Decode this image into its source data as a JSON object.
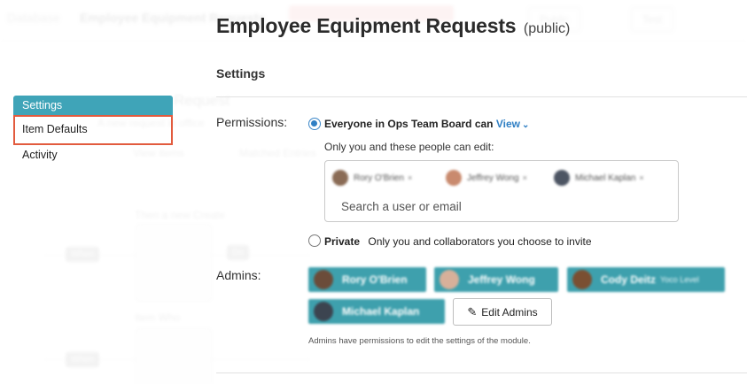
{
  "background": {
    "crumb_left": "Database",
    "crumb_title": "Employee Equipment Requests",
    "right_button_1": "Public",
    "right_button_2": "Test",
    "module_title": "Request",
    "module_sub": "A new request in office",
    "view_items": "View items",
    "matched_entries": "Matched Entries",
    "then_label": "Then a new Create",
    "item_label": "Item Who",
    "when_label": "When",
    "do_label": "Do"
  },
  "nav": {
    "items": [
      {
        "label": "Settings",
        "active": true
      },
      {
        "label": "Item Defaults",
        "highlighted": true
      },
      {
        "label": "Activity"
      }
    ]
  },
  "header": {
    "title": "Employee Equipment Requests",
    "visibility": "(public)"
  },
  "settings": {
    "section_title": "Settings",
    "permissions_label": "Permissions:",
    "everyone_option": "Everyone in Ops Team Board can",
    "view_level": "View",
    "edit_caption": "Only you and these people can edit:",
    "editors": [
      {
        "name": "Rory O'Brien",
        "color": "#8a6b55"
      },
      {
        "name": "Jeffrey Wong",
        "color": "#c98a6e"
      },
      {
        "name": "Michael Kaplan",
        "color": "#4d5563"
      }
    ],
    "search_placeholder": "Search a user  or email",
    "private_option": "Private",
    "private_caption": "Only you and collaborators you choose to invite",
    "admins_label": "Admins:",
    "admins": [
      {
        "name": "Rory O'Brien",
        "extra": "",
        "color": "#6b4c3a"
      },
      {
        "name": "Jeffrey Wong",
        "extra": "",
        "color": "#d7b09a"
      },
      {
        "name": "Cody Deitz",
        "extra": "Yoco Level",
        "color": "#7a4f32"
      },
      {
        "name": "Michael Kaplan",
        "extra": "",
        "color": "#3c4450"
      }
    ],
    "edit_admins_button": "Edit Admins",
    "admins_hint": "Admins have permissions to edit the settings of the module."
  },
  "colors": {
    "accent": "#3fa4b8",
    "admin_pill": "#3ea0ad",
    "link": "#2f7fc4",
    "highlight_border": "#e25b3e"
  }
}
